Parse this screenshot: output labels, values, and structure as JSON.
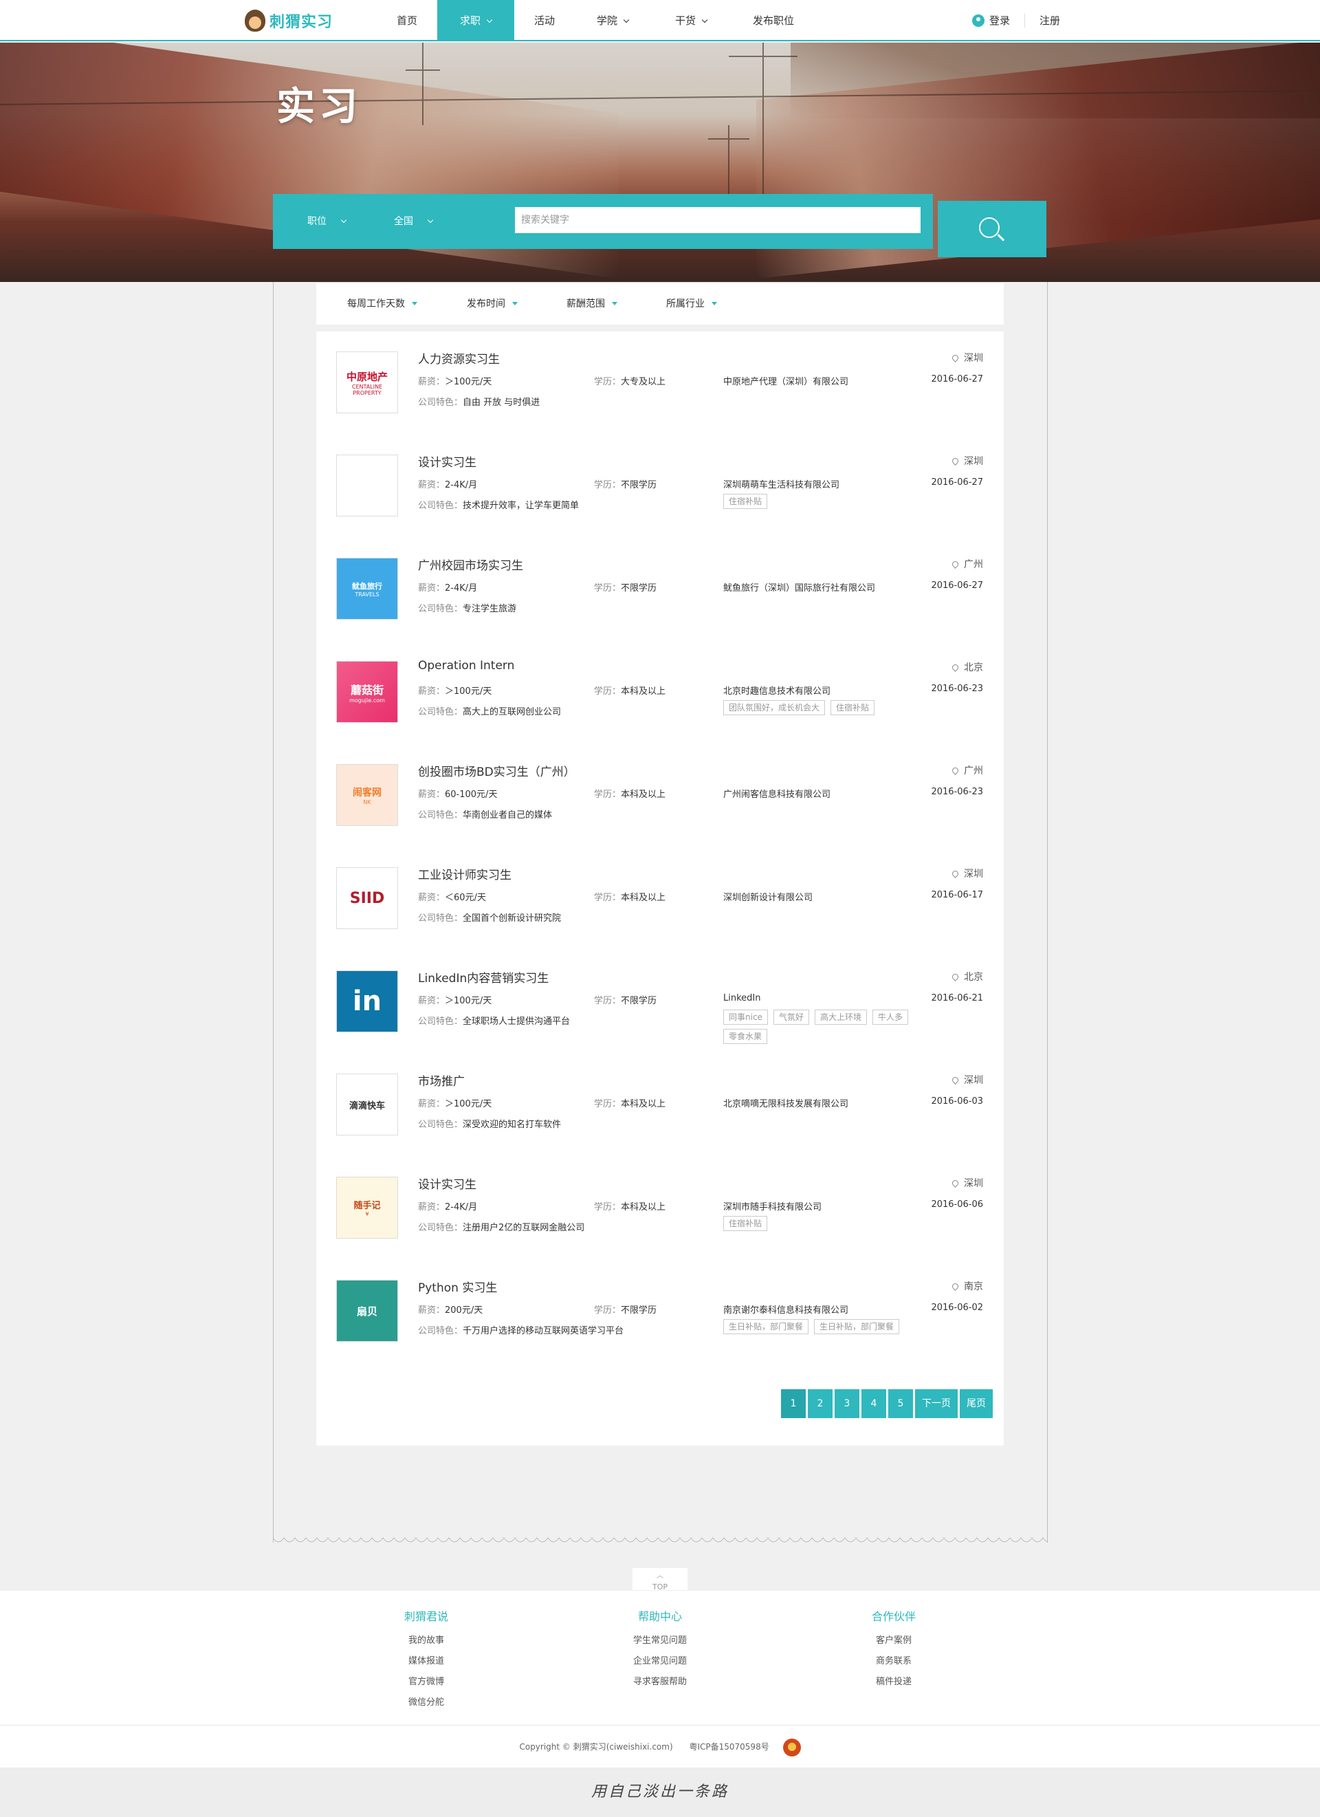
{
  "nav": {
    "logo_text": "刺猬实习",
    "items": [
      {
        "label": "首页",
        "dropdown": false
      },
      {
        "label": "求职",
        "dropdown": true
      },
      {
        "label": "活动",
        "dropdown": false
      },
      {
        "label": "学院",
        "dropdown": true
      },
      {
        "label": "干货",
        "dropdown": true
      },
      {
        "label": "发布职位",
        "dropdown": false
      }
    ],
    "active_index": 1,
    "login": "登录",
    "register": "注册"
  },
  "hero": {
    "title": "实习",
    "position_select": "职位",
    "region_select": "全国",
    "search_placeholder": "搜索关键字"
  },
  "filters": [
    "每周工作天数",
    "发布时间",
    "薪酬范围",
    "所属行业"
  ],
  "labels": {
    "salary": "薪资：",
    "education": "学历：",
    "feature": "公司特色："
  },
  "jobs": [
    {
      "title": "人力资源实习生",
      "salary": "＞100元/天",
      "education": "大专及以上",
      "feature": "自由 开放 与时俱进",
      "company": "中原地产代理（深圳）有限公司",
      "tags": [],
      "city": "深圳",
      "date": "2016-06-27",
      "logo_text": "中原地产",
      "logo_sub": "CENTALINE PROPERTY"
    },
    {
      "title": "设计实习生",
      "salary": "2-4K/月",
      "education": "不限学历",
      "feature": "技术提升效率，让学车更简单",
      "company": "深圳萌萌车生活科技有限公司",
      "tags": [
        "住宿补贴"
      ],
      "city": "深圳",
      "date": "2016-06-27",
      "logo_text": "",
      "logo_sub": ""
    },
    {
      "title": "广州校园市场实习生",
      "salary": "2-4K/月",
      "education": "不限学历",
      "feature": "专注学生旅游",
      "company": "鱿鱼旅行（深圳）国际旅行社有限公司",
      "tags": [],
      "city": "广州",
      "date": "2016-06-27",
      "logo_text": "鱿鱼旅行",
      "logo_sub": "TRAVELS"
    },
    {
      "title": "Operation Intern",
      "salary": "＞100元/天",
      "education": "本科及以上",
      "feature": "高大上的互联网创业公司",
      "company": "北京时趣信息技术有限公司",
      "tags": [
        "团队氛围好，成长机会大",
        "住宿补贴"
      ],
      "city": "北京",
      "date": "2016-06-23",
      "logo_text": "蘑菇街",
      "logo_sub": "mogujie.com"
    },
    {
      "title": "创投圈市场BD实习生（广州）",
      "salary": "60-100元/天",
      "education": "本科及以上",
      "feature": "华南创业者自己的媒体",
      "company": "广州闹客信息科技有限公司",
      "tags": [],
      "city": "广州",
      "date": "2016-06-23",
      "logo_text": "闹客网",
      "logo_sub": "NK"
    },
    {
      "title": "工业设计师实习生",
      "salary": "＜60元/天",
      "education": "本科及以上",
      "feature": "全国首个创新设计研究院",
      "company": "深圳创新设计有限公司",
      "tags": [],
      "city": "深圳",
      "date": "2016-06-17",
      "logo_text": "SIID",
      "logo_sub": ""
    },
    {
      "title": "LinkedIn内容营销实习生",
      "salary": "＞100元/天",
      "education": "不限学历",
      "feature": "全球职场人士提供沟通平台",
      "company": "LinkedIn",
      "tags": [
        "同事nice",
        "气氛好",
        "高大上环境",
        "牛人多",
        "零食水果"
      ],
      "city": "北京",
      "date": "2016-06-21",
      "logo_text": "in",
      "logo_sub": ""
    },
    {
      "title": "市场推广",
      "salary": "＞100元/天",
      "education": "本科及以上",
      "feature": "深受欢迎的知名打车软件",
      "company": "北京嘀嘀无限科技发展有限公司",
      "tags": [],
      "city": "深圳",
      "date": "2016-06-03",
      "logo_text": "滴滴快车",
      "logo_sub": ""
    },
    {
      "title": "设计实习生",
      "salary": "2-4K/月",
      "education": "本科及以上",
      "feature": "注册用户2亿的互联网金融公司",
      "company": "深圳市随手科技有限公司",
      "tags": [
        "住宿补贴"
      ],
      "city": "深圳",
      "date": "2016-06-06",
      "logo_text": "随手记",
      "logo_sub": "¥"
    },
    {
      "title": "Python 实习生",
      "salary": "200元/天",
      "education": "不限学历",
      "feature": "千万用户选择的移动互联网英语学习平台",
      "company": "南京谢尔泰科信息科技有限公司",
      "tags": [
        "生日补贴，部门聚餐",
        "生日补贴，部门聚餐"
      ],
      "city": "南京",
      "date": "2016-06-02",
      "logo_text": "扇贝",
      "logo_sub": ""
    }
  ],
  "pagination": [
    "1",
    "2",
    "3",
    "4",
    "5",
    "下一页",
    "尾页"
  ],
  "top_label": "TOP",
  "footer": {
    "cols": [
      {
        "title": "刺猬君说",
        "links": [
          "我的故事",
          "媒体报道",
          "官方微博",
          "微信分舵"
        ]
      },
      {
        "title": "帮助中心",
        "links": [
          "学生常见问题",
          "企业常见问题",
          "寻求客服帮助"
        ]
      },
      {
        "title": "合作伙伴",
        "links": [
          "客户案例",
          "商务联系",
          "稿件投递"
        ]
      }
    ],
    "copyright": "Copyright © 刺猬实习(ciweishixi.com)",
    "icp": "粤ICP备15070598号",
    "slogan": "用自己淡出一条路"
  },
  "colors": {
    "accent": "#2fb8bd"
  }
}
